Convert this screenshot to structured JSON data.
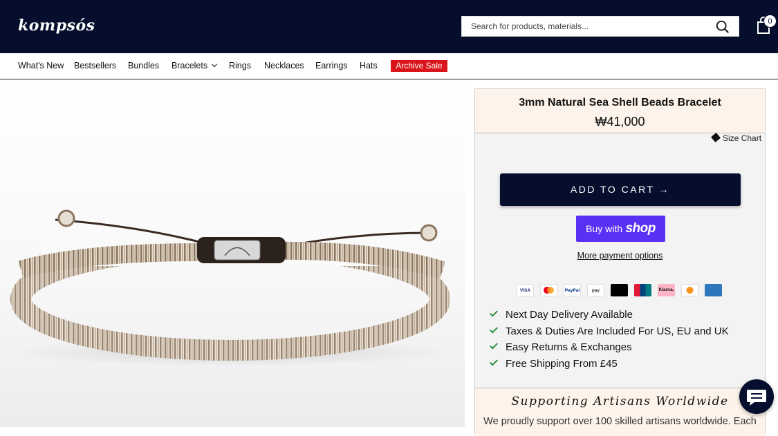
{
  "header": {
    "logo": "kompsós",
    "search": {
      "placeholder": "Search for products, materials..."
    },
    "cart_count": "0"
  },
  "nav": {
    "items": [
      "What's New",
      "Bestsellers",
      "Bundles",
      "Bracelets",
      "Rings",
      "Necklaces",
      "Earrings",
      "Hats"
    ],
    "sale_label": "Archive Sale"
  },
  "product": {
    "title": "3mm Natural Sea Shell Beads Bracelet",
    "price": "₩41,000",
    "size_chart": "Size Chart",
    "add_to_cart": "ADD TO CART",
    "shop_pay": {
      "prefix": "Buy with",
      "brand": "shop"
    },
    "more_payment": "More payment options",
    "payment_icons": [
      "VISA",
      "mastercard",
      "PayPal",
      "pay",
      "Apple Pay",
      "UnionPay",
      "Klarna.",
      "bitcoin",
      "AMEX"
    ],
    "features": [
      "Next Day Delivery Available",
      "Taxes & Duties Are Included For US, EU and UK",
      "Easy Returns & Exchanges",
      "Free Shipping From £45"
    ]
  },
  "support": {
    "title": "Supporting Artisans Worldwide",
    "text": "We proudly support over 100 skilled artisans worldwide. Each"
  },
  "colors": {
    "header_bg": "#050e2d",
    "sale_bg": "#d9141b",
    "shop_pay": "#5a31f4",
    "check": "#2f8f3b"
  }
}
